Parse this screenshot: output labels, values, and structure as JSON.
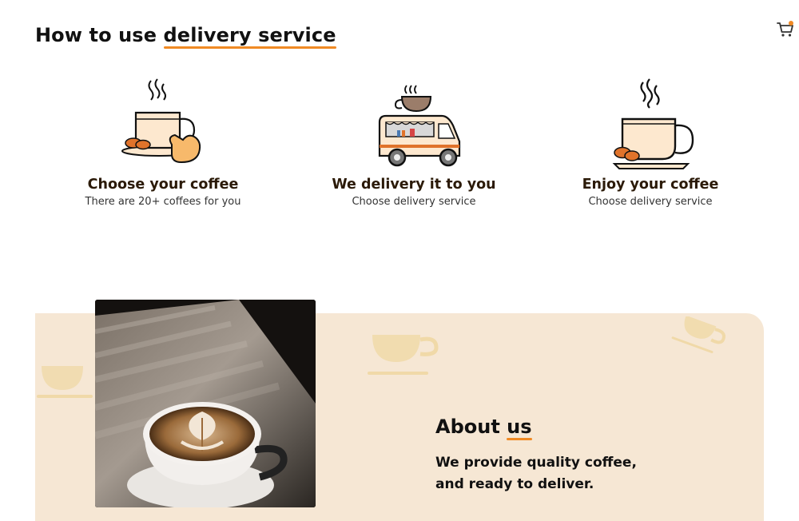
{
  "header": {
    "title_prefix": "How to use ",
    "title_highlight": "delivery service"
  },
  "cart": {
    "icon": "cart-icon",
    "has_notification": true
  },
  "steps": [
    {
      "icon": "coffee-cup-hand-icon",
      "title": "Choose your coffee",
      "subtitle": "There are 20+ coffees for you"
    },
    {
      "icon": "delivery-van-icon",
      "title": "We delivery it to you",
      "subtitle": "Choose delivery service"
    },
    {
      "icon": "coffee-cup-steam-icon",
      "title": "Enjoy your coffee",
      "subtitle": "Choose delivery service"
    }
  ],
  "about": {
    "title_prefix": "About ",
    "title_highlight": "us",
    "line1": "We provide quality coffee,",
    "line2": "and ready to deliver."
  },
  "colors": {
    "accent": "#f08a24",
    "about_bg": "#f6e7d4",
    "cup": "#fde8cf",
    "bean": "#e0732b",
    "outline": "#111111"
  }
}
